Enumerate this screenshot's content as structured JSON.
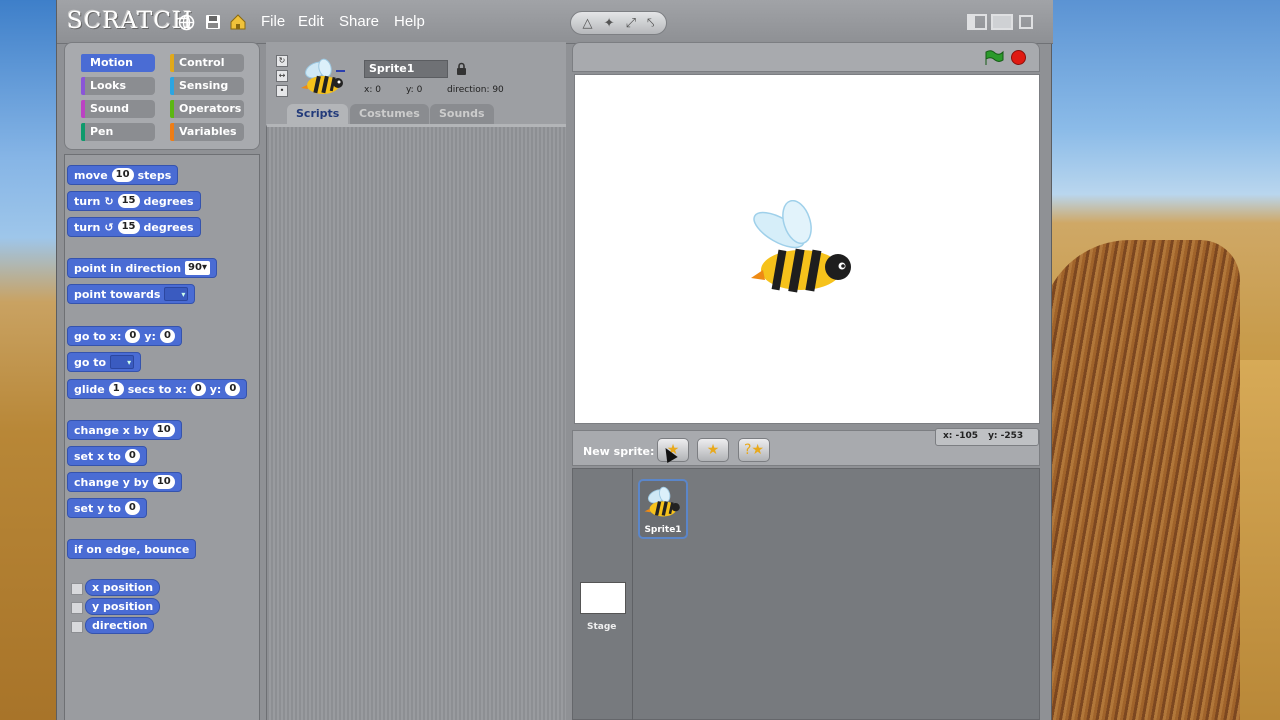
{
  "app": {
    "logo": "SCRATCH",
    "menus": [
      "File",
      "Edit",
      "Share",
      "Help"
    ]
  },
  "categories": [
    {
      "label": "Motion",
      "id": "motion",
      "selected": true
    },
    {
      "label": "Control",
      "id": "control"
    },
    {
      "label": "Looks",
      "id": "looks"
    },
    {
      "label": "Sensing",
      "id": "sensing"
    },
    {
      "label": "Sound",
      "id": "sound"
    },
    {
      "label": "Operators",
      "id": "operators"
    },
    {
      "label": "Pen",
      "id": "pen"
    },
    {
      "label": "Variables",
      "id": "variables"
    }
  ],
  "blocks": {
    "move": {
      "pre": "move",
      "value": "10",
      "post": "steps"
    },
    "turn_right": {
      "pre": "turn",
      "value": "15",
      "post": "degrees"
    },
    "turn_left": {
      "pre": "turn",
      "value": "15",
      "post": "degrees"
    },
    "point_direction": {
      "pre": "point in direction",
      "value": "90"
    },
    "point_towards": {
      "pre": "point towards"
    },
    "goto_xy": {
      "pre": "go to x:",
      "x": "0",
      "mid": "y:",
      "y": "0"
    },
    "goto": {
      "pre": "go to"
    },
    "glide": {
      "pre": "glide",
      "secs": "1",
      "mid1": "secs to x:",
      "x": "0",
      "mid2": "y:",
      "y": "0"
    },
    "change_x": {
      "pre": "change x by",
      "value": "10"
    },
    "set_x": {
      "pre": "set x to",
      "value": "0"
    },
    "change_y": {
      "pre": "change y by",
      "value": "10"
    },
    "set_y": {
      "pre": "set y to",
      "value": "0"
    },
    "bounce": {
      "label": "if on edge, bounce"
    },
    "x_position": {
      "label": "x position"
    },
    "y_position": {
      "label": "y position"
    },
    "direction": {
      "label": "direction"
    }
  },
  "sprite": {
    "name": "Sprite1",
    "x_label": "x: 0",
    "y_label": "y: 0",
    "direction_label": "direction: 90"
  },
  "tabs": [
    "Scripts",
    "Costumes",
    "Sounds"
  ],
  "active_tab": "Scripts",
  "stage": {
    "mouse_x": "x: -105",
    "mouse_y": "y: -253"
  },
  "sprite_area": {
    "new_sprite_label": "New sprite:",
    "sprites": [
      {
        "name": "Sprite1"
      }
    ],
    "stage_label": "Stage"
  },
  "colors": {
    "motion": "#4a6cd4",
    "stop": "#e01a12",
    "flag": "#2b9a2b",
    "bee_yellow": "#f6c21b"
  }
}
